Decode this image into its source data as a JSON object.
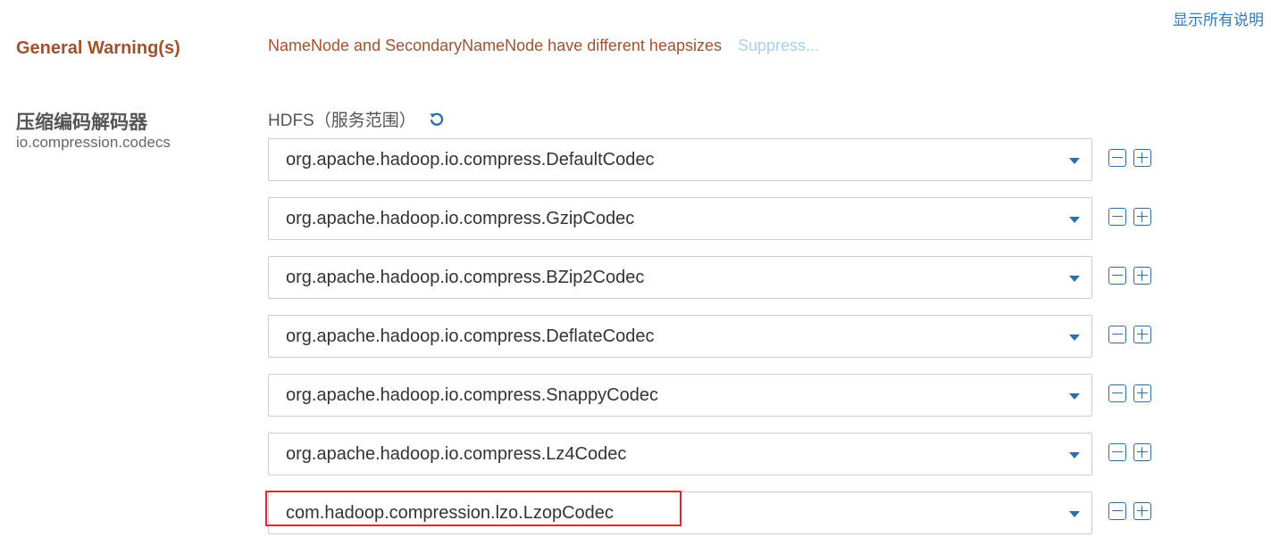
{
  "header": {
    "show_all_descriptions": "显示所有说明"
  },
  "warning": {
    "label": "General Warning(s)",
    "message": "NameNode and SecondaryNameNode have different heapsizes",
    "suppress": "Suppress..."
  },
  "param": {
    "title": "压缩编码解码器",
    "key": "io.compression.codecs",
    "scope": "HDFS（服务范围）",
    "reset_icon": "undo-icon",
    "codecs": [
      "org.apache.hadoop.io.compress.DefaultCodec",
      "org.apache.hadoop.io.compress.GzipCodec",
      "org.apache.hadoop.io.compress.BZip2Codec",
      "org.apache.hadoop.io.compress.DeflateCodec",
      "org.apache.hadoop.io.compress.SnappyCodec",
      "org.apache.hadoop.io.compress.Lz4Codec",
      "com.hadoop.compression.lzo.LzopCodec"
    ],
    "highlighted_index": 6
  },
  "colors": {
    "warning": "#a0522d",
    "link": "#2f7ab9",
    "suppress": "#a8d0ec",
    "control_blue": "#2f6fa8",
    "highlight_red": "#e3262f"
  }
}
